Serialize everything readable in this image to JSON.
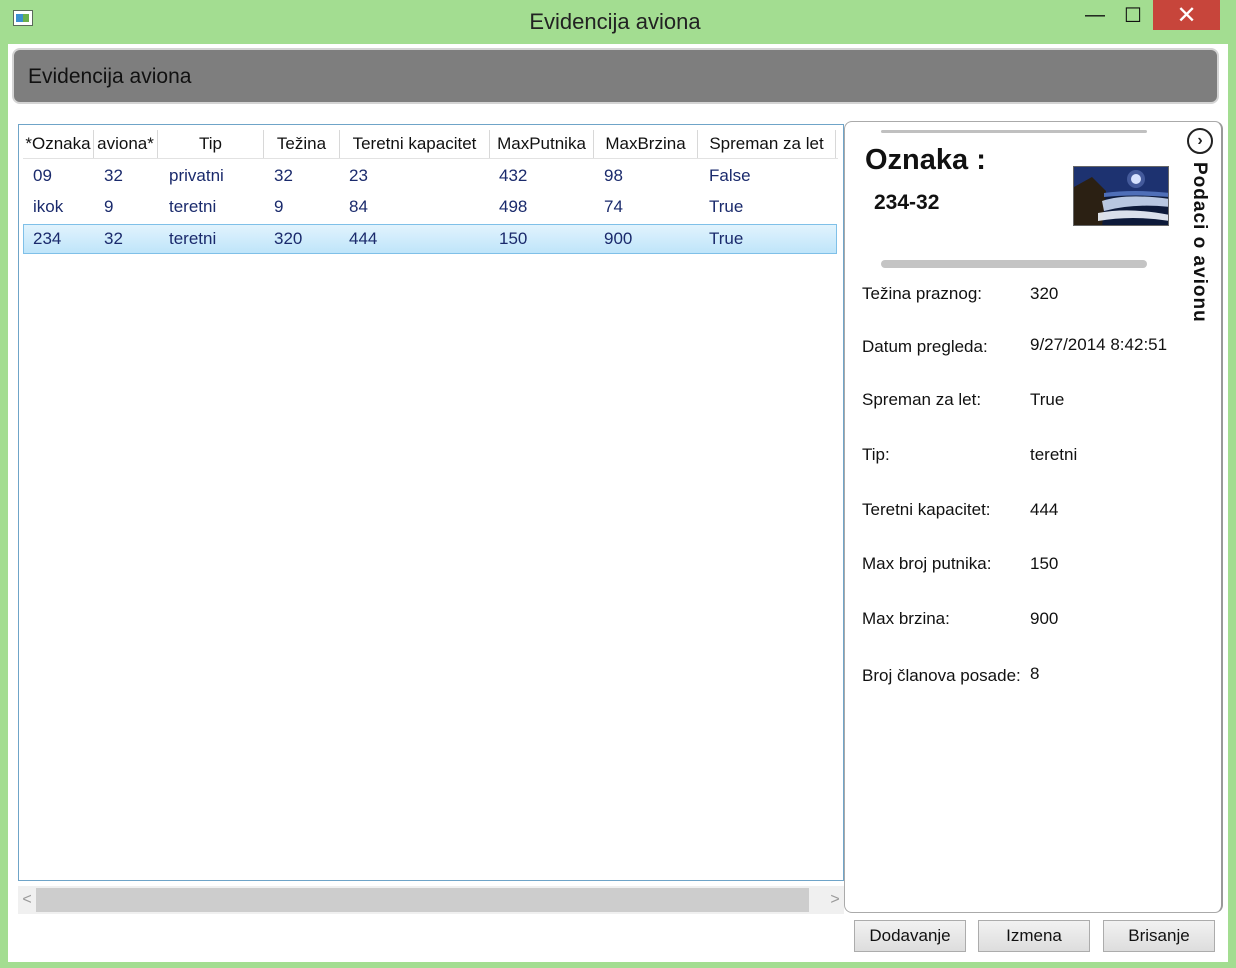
{
  "window": {
    "title": "Evidencija aviona",
    "minimize": "—",
    "maximize": "☐",
    "close": "✕"
  },
  "header": {
    "title": "Evidencija aviona"
  },
  "grid": {
    "columns": [
      "*Oznaka",
      "aviona*",
      "Tip",
      "Težina",
      "Teretni kapacitet",
      "MaxPutnika",
      "MaxBrzina",
      "Spreman za let"
    ],
    "rows": [
      [
        "09",
        "32",
        "privatni",
        "32",
        "23",
        "432",
        "98",
        "False"
      ],
      [
        "ikok",
        "9",
        "teretni",
        "9",
        "84",
        "498",
        "74",
        "True"
      ],
      [
        "234",
        "32",
        "teretni",
        "320",
        "444",
        "150",
        "900",
        "True"
      ]
    ],
    "selected_row": 2
  },
  "scrollbar": {
    "left_arrow": "<",
    "right_arrow": ">"
  },
  "detail": {
    "oznaka_label": "Oznaka :",
    "oznaka_value": "234-32",
    "panel_title": "Podaci o avionu",
    "toggle_icon": "chevron-right-circle-icon",
    "fields": [
      {
        "label": "Težina praznog:",
        "value": "320"
      },
      {
        "label": "Datum pregleda:",
        "value": "9/27/2014 8:42:51"
      },
      {
        "label": "Spreman za let:",
        "value": "True"
      },
      {
        "label": "Tip:",
        "value": "teretni"
      },
      {
        "label": "Teretni kapacitet:",
        "value": "444"
      },
      {
        "label": "Max broj putnika:",
        "value": "150"
      },
      {
        "label": "Max brzina:",
        "value": "900"
      },
      {
        "label": "Broj članova posade:",
        "value": "8"
      }
    ]
  },
  "buttons": {
    "add": "Dodavanje",
    "edit": "Izmena",
    "delete": "Brisanje"
  },
  "colors": {
    "window_frame": "#a3dd91",
    "close_button": "#c7453b",
    "header_bar": "#7e7e7e",
    "row_text": "#1a2a6c",
    "selection": "#bfe5fa"
  }
}
